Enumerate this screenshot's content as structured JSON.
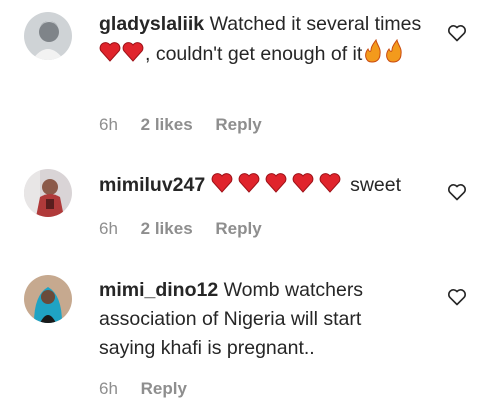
{
  "comments": [
    {
      "username": "gladyslaliik",
      "text_1": "Watched it several times",
      "emoji_1": "heart-emoji x2",
      "text_2": ", couldn't get enough of it",
      "emoji_2": "fire-emoji x2",
      "time": "6h",
      "likes": "2 likes",
      "reply": "Reply"
    },
    {
      "username": "mimiluv247",
      "emoji_1": "heart-emoji x5",
      "text_2": "sweet",
      "time": "6h",
      "likes": "2 likes",
      "reply": "Reply"
    },
    {
      "username": "mimi_dino12",
      "text_1": "Womb watchers association of Nigeria will start saying khafi is pregnant..",
      "time": "6h",
      "reply": "Reply"
    }
  ],
  "colors": {
    "text": "#262626",
    "meta": "#8e8e8e",
    "heart": "#e0242c",
    "fire": "#f39a1c"
  },
  "icons": {
    "like": "heart-outline-icon"
  }
}
